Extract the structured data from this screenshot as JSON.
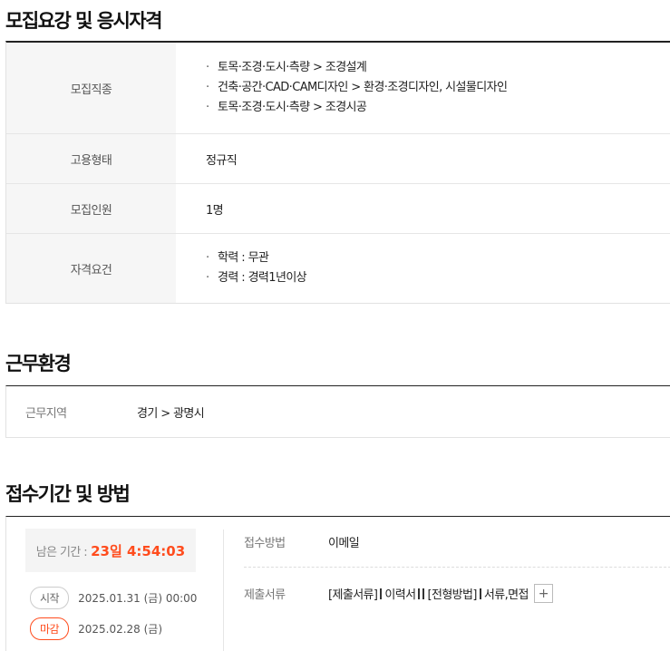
{
  "recruit": {
    "title": "모집요강 및 응시자격",
    "rows": {
      "job_label": "모집직종",
      "job_items": [
        "토목·조경·도시·측량 > 조경설계",
        "건축·공간·CAD·CAM디자인 > 환경·조경디자인, 시설물디자인",
        "토목·조경·도시·측량 > 조경시공"
      ],
      "employment_label": "고용형태",
      "employment_value": "정규직",
      "headcount_label": "모집인원",
      "headcount_value": "1명",
      "qual_label": "자격요건",
      "qual_items": [
        "학력 : 무관",
        "경력 : 경력1년이상"
      ]
    },
    "bullet": "·"
  },
  "environment": {
    "title": "근무환경",
    "location_label": "근무지역",
    "location_value": "경기 > 광명시"
  },
  "apply": {
    "title": "접수기간 및 방법",
    "remaining_label": "남은 기간 :",
    "remaining_time": "23일 4:54:03",
    "start_pill": "시작",
    "start_date": "2025.01.31 (금) 00:00",
    "deadline_pill": "마감",
    "deadline_date": "2025.02.28 (금)",
    "method_label": "접수방법",
    "method_value": "이메일",
    "docs_label": "제출서류",
    "docs_part1": "[제출서류]",
    "docs_part2": "이력서",
    "docs_part3": "[전형방법]",
    "docs_part4": "서류,면접",
    "plus": "+"
  }
}
